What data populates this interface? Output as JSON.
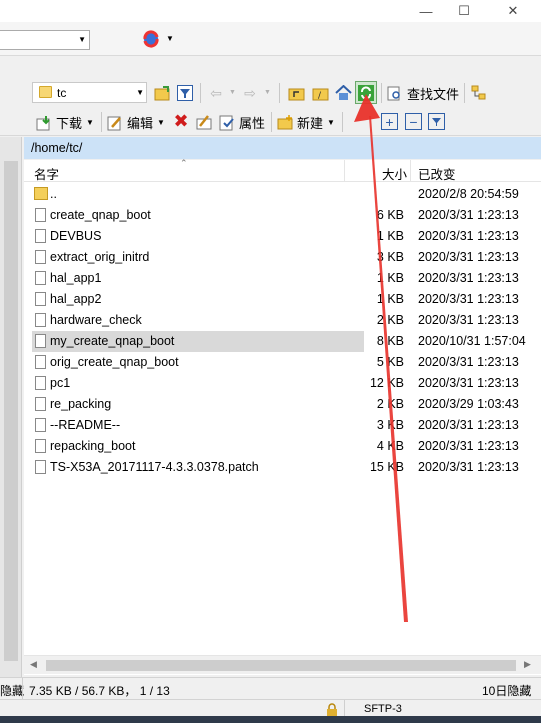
{
  "path_bar": {
    "current_folder": "tc"
  },
  "toolbar": {
    "find_files_label": "查找文件",
    "download_label": "下载",
    "edit_label": "编辑",
    "properties_label": "属性",
    "new_label": "新建"
  },
  "current_path": "/home/tc/",
  "columns": {
    "name": "名字",
    "size": "大小",
    "modified": "已改变"
  },
  "files": [
    {
      "name": "..",
      "size": "",
      "modified": "2020/2/8 20:54:59",
      "type": "parent"
    },
    {
      "name": "create_qnap_boot",
      "size": "6 KB",
      "modified": "2020/3/31 1:23:13",
      "type": "file"
    },
    {
      "name": "DEVBUS",
      "size": "1 KB",
      "modified": "2020/3/31 1:23:13",
      "type": "file"
    },
    {
      "name": "extract_orig_initrd",
      "size": "3 KB",
      "modified": "2020/3/31 1:23:13",
      "type": "file"
    },
    {
      "name": "hal_app1",
      "size": "1 KB",
      "modified": "2020/3/31 1:23:13",
      "type": "file"
    },
    {
      "name": "hal_app2",
      "size": "1 KB",
      "modified": "2020/3/31 1:23:13",
      "type": "file"
    },
    {
      "name": "hardware_check",
      "size": "2 KB",
      "modified": "2020/3/31 1:23:13",
      "type": "file"
    },
    {
      "name": "my_create_qnap_boot",
      "size": "8 KB",
      "modified": "2020/10/31 1:57:04",
      "type": "file",
      "selected": true
    },
    {
      "name": "orig_create_qnap_boot",
      "size": "5 KB",
      "modified": "2020/3/31 1:23:13",
      "type": "file"
    },
    {
      "name": "pc1",
      "size": "12 KB",
      "modified": "2020/3/31 1:23:13",
      "type": "file"
    },
    {
      "name": "re_packing",
      "size": "2 KB",
      "modified": "2020/3/29 1:03:43",
      "type": "file"
    },
    {
      "name": "--README--",
      "size": "3 KB",
      "modified": "2020/3/31 1:23:13",
      "type": "file"
    },
    {
      "name": "repacking_boot",
      "size": "4 KB",
      "modified": "2020/3/31 1:23:13",
      "type": "file"
    },
    {
      "name": "TS-X53A_20171117-4.3.3.0378.patch",
      "size": "15 KB",
      "modified": "2020/3/31 1:23:13",
      "type": "file"
    }
  ],
  "status": {
    "left_fragment": "隐藏",
    "selection": "7.35 KB / 56.7 KB， 1 / 13",
    "hidden": "10日隐藏",
    "protocol": "SFTP-3"
  },
  "colors": {
    "selected_row": "#d9d9d9",
    "path_header": "#cce2f7",
    "annotation_arrow": "#e8312a"
  }
}
